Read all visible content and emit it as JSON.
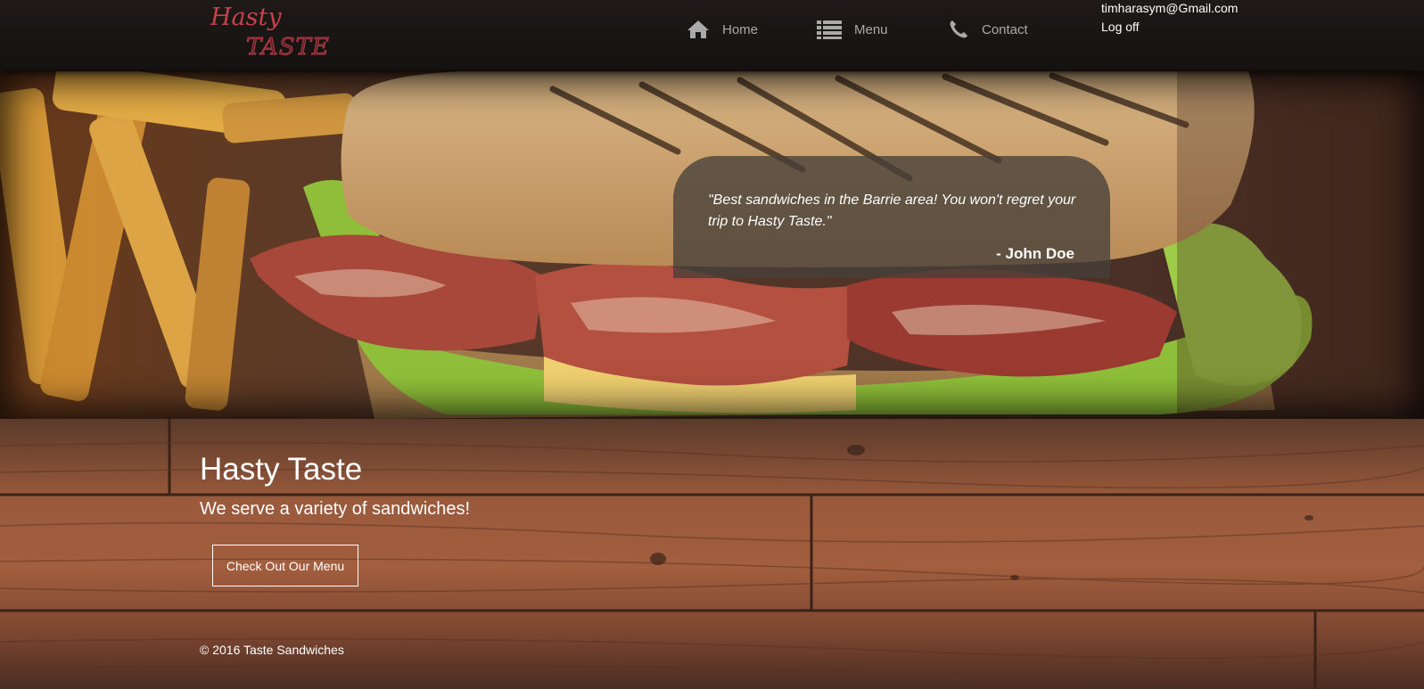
{
  "header": {
    "logo": {
      "line1": "Hasty",
      "line2": "TASTE"
    },
    "nav": [
      {
        "label": "Home",
        "icon": "home-icon"
      },
      {
        "label": "Menu",
        "icon": "list-icon"
      },
      {
        "label": "Contact",
        "icon": "phone-icon"
      }
    ],
    "user_email": "timharasym@Gmail.com",
    "logoff_label": "Log off"
  },
  "hero": {
    "quote": "\"Best sandwiches in the Barrie area! You won't regret your trip to Hasty Taste.\"",
    "author": "- John Doe"
  },
  "main": {
    "title": "Hasty Taste",
    "subtitle": "We serve a variety of sandwiches!",
    "cta_label": "Check Out Our Menu"
  },
  "footer": {
    "copyright": "© 2016 Taste Sandwiches"
  },
  "colors": {
    "logo": "#c8404a",
    "nav_text": "#aaaaaa",
    "header_bg": "#1a1614",
    "wood": "#a25e3e"
  }
}
